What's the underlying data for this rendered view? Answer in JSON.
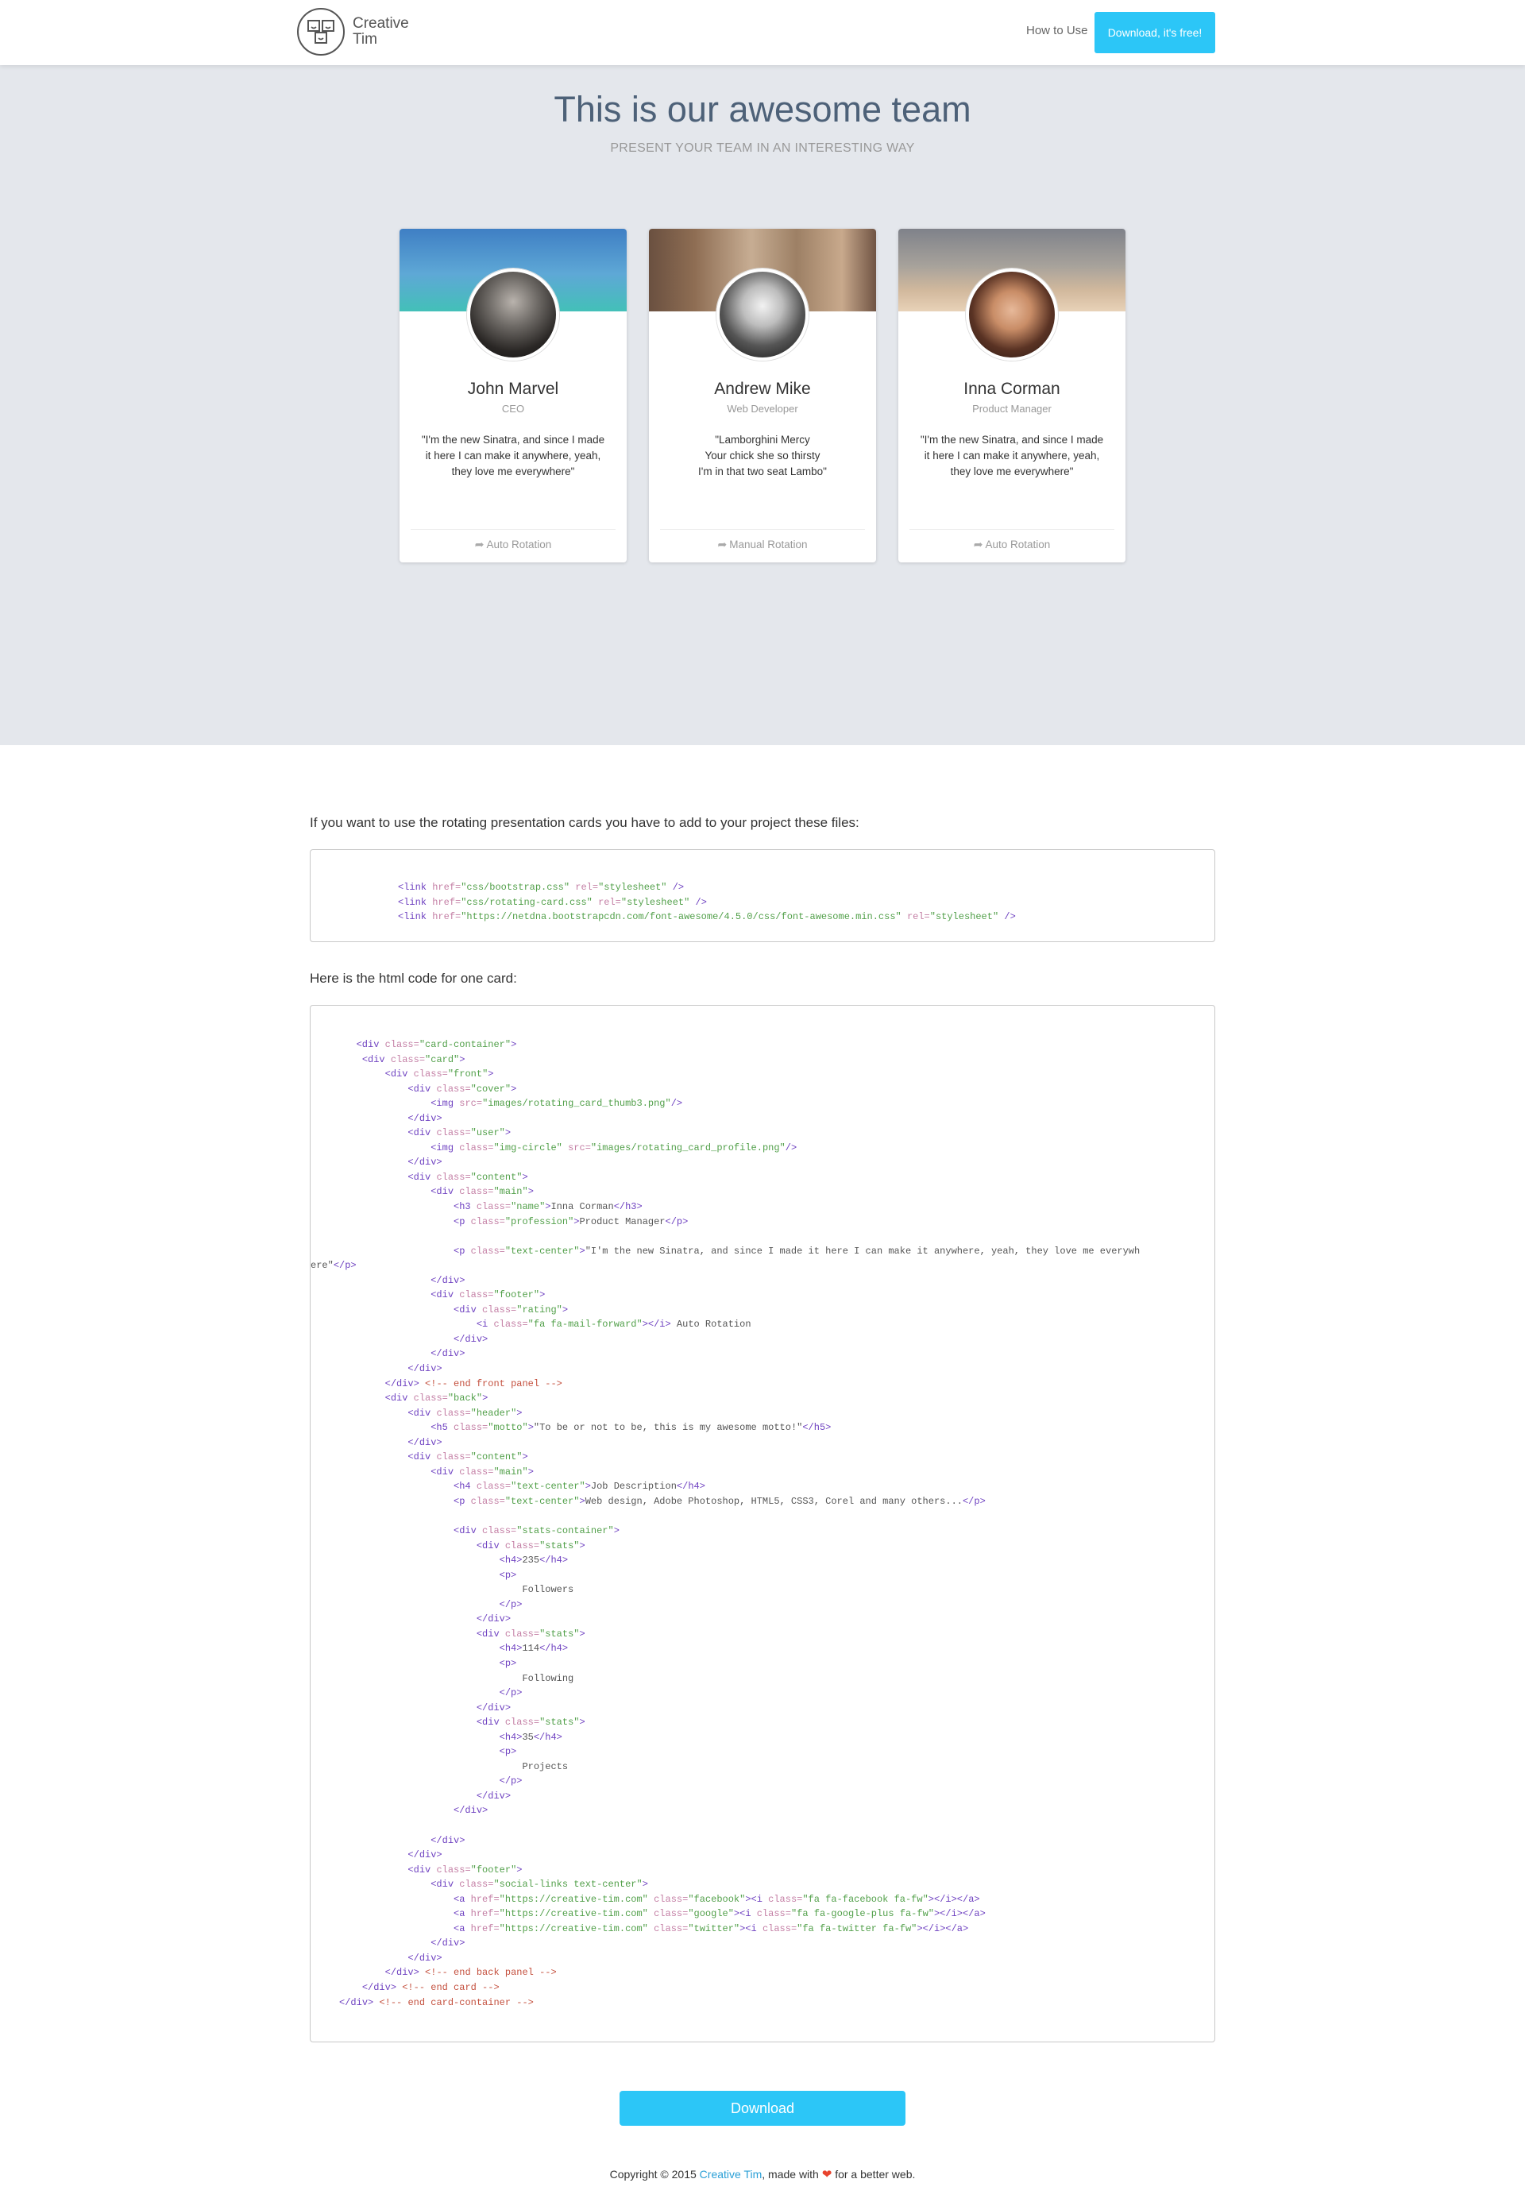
{
  "nav": {
    "brand_line1": "Creative",
    "brand_line2": "Tim",
    "how_to_use": "How to Use",
    "download_label": "Download, it's free!"
  },
  "hero": {
    "title": "This is our awesome team",
    "subtitle": "PRESENT YOUR TEAM IN AN INTERESTING WAY"
  },
  "cards": [
    {
      "name": "John Marvel",
      "role": "CEO",
      "quote_lines": [
        "\"I'm the new Sinatra, and since I made",
        "it here I can make it anywhere, yeah,",
        "they love me everywhere\""
      ],
      "footer": "Auto Rotation"
    },
    {
      "name": "Andrew Mike",
      "role": "Web Developer",
      "quote_lines": [
        "\"Lamborghini Mercy",
        "Your chick she so thirsty",
        "I'm in that two seat Lambo\""
      ],
      "footer": "Manual Rotation"
    },
    {
      "name": "Inna Corman",
      "role": "Product Manager",
      "quote_lines": [
        "\"I'm the new Sinatra, and since I made",
        "it here I can make it anywhere, yeah,",
        "they love me everywhere\""
      ],
      "footer": "Auto Rotation"
    }
  ],
  "instructions": {
    "files_intro": "If you want to use the rotating presentation cards you have to add to your project these files:",
    "html_intro": "Here is the html code for one card:"
  },
  "download_button": "Download",
  "footer": {
    "prefix": "Copyright © 2015 ",
    "link": "Creative Tim",
    "middle": ", made with ",
    "suffix": " for a better web."
  },
  "icons": {
    "forward": "mail-forward-icon",
    "heart": "heart-icon",
    "logo": "creative-tim-logo"
  },
  "colors": {
    "accent": "#2cc6f7",
    "hero_bg": "#e4e7ec",
    "title": "#4d6178"
  }
}
